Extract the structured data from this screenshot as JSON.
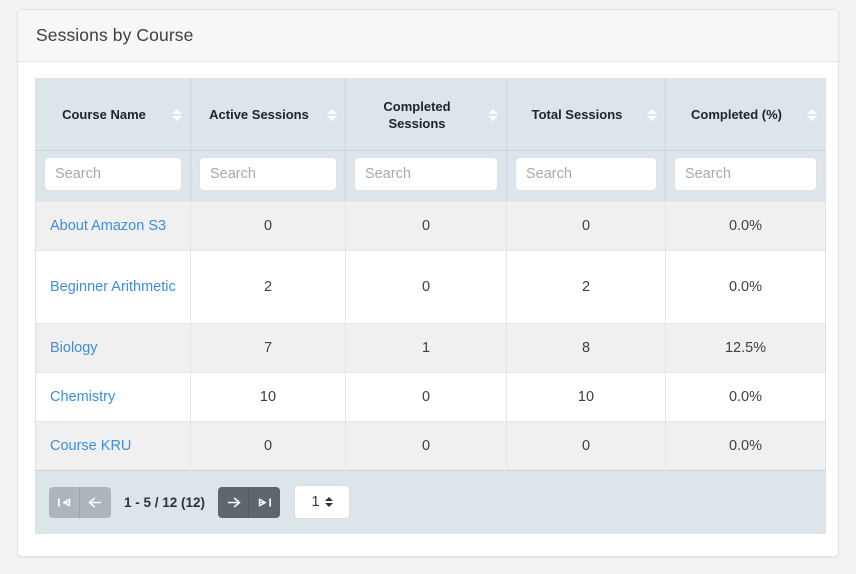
{
  "panel": {
    "title": "Sessions by Course"
  },
  "table": {
    "columns": [
      {
        "label": "Course Name",
        "sort_icon": "sort-both-icon",
        "align": "center"
      },
      {
        "label": "Active Sessions",
        "sort_icon": "sort-both-icon",
        "align": "center"
      },
      {
        "label": "Completed Sessions",
        "sort_icon": "sort-both-icon",
        "align": "center"
      },
      {
        "label": "Total Sessions",
        "sort_icon": "sort-both-icon",
        "align": "center"
      },
      {
        "label": "Completed (%)",
        "sort_icon": "sort-both-icon",
        "align": "center"
      }
    ],
    "filters": [
      {
        "placeholder": "Search",
        "value": ""
      },
      {
        "placeholder": "Search",
        "value": ""
      },
      {
        "placeholder": "Search",
        "value": ""
      },
      {
        "placeholder": "Search",
        "value": ""
      },
      {
        "placeholder": "Search",
        "value": ""
      }
    ],
    "rows": [
      {
        "course_name": "About Amazon S3",
        "active_sessions": "0",
        "completed_sessions": "0",
        "total_sessions": "0",
        "completed_pct": "0.0%"
      },
      {
        "course_name": "Beginner Arithmetic",
        "active_sessions": "2",
        "completed_sessions": "0",
        "total_sessions": "2",
        "completed_pct": "0.0%"
      },
      {
        "course_name": "Biology",
        "active_sessions": "7",
        "completed_sessions": "1",
        "total_sessions": "8",
        "completed_pct": "12.5%"
      },
      {
        "course_name": "Chemistry",
        "active_sessions": "10",
        "completed_sessions": "0",
        "total_sessions": "10",
        "completed_pct": "0.0%"
      },
      {
        "course_name": "Course KRU",
        "active_sessions": "0",
        "completed_sessions": "0",
        "total_sessions": "0",
        "completed_pct": "0.0%"
      }
    ]
  },
  "pagination": {
    "first_label": "first-page-icon",
    "prev_label": "previous-page-icon",
    "next_label": "next-page-icon",
    "last_label": "last-page-icon",
    "info": "1 - 5 / 12 (12)",
    "page_value": "1",
    "first_enabled": false,
    "prev_enabled": false,
    "next_enabled": true,
    "last_enabled": true
  },
  "colors": {
    "header_bg": "#dce5e9",
    "link": "#3e8edd",
    "row_odd_bg": "#f0f0f0",
    "row_even_bg": "#ffffff",
    "pager_active": "#5e676e",
    "pager_disabled": "#aeb6bb"
  }
}
